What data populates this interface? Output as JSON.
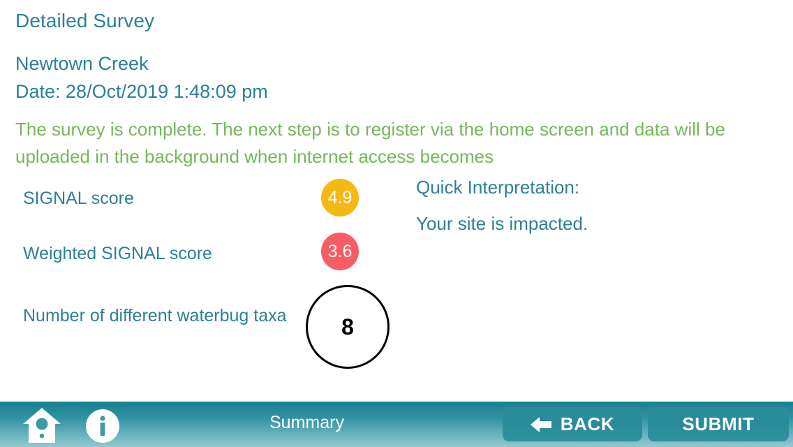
{
  "header": {
    "page_title": "Detailed Survey",
    "site_name": "Newtown Creek",
    "date_line": "Date: 28/Oct/2019 1:48:09 pm"
  },
  "status": {
    "message": "The survey is complete. The next step is to register via the home screen and data will be uploaded in the background when internet access becomes"
  },
  "results": {
    "signal": {
      "label": "SIGNAL score",
      "value": "4.9",
      "color": "#f5b916"
    },
    "weighted_signal": {
      "label": "Weighted SIGNAL score",
      "value": "3.6",
      "color": "#f85c64"
    },
    "taxa": {
      "label": "Number of different waterbug taxa",
      "value": "8",
      "color": "#000000"
    }
  },
  "interpretation": {
    "title": "Quick Interpretation:",
    "text": "Your site is impacted."
  },
  "bottom_bar": {
    "screen_label": "Summary",
    "home_icon": "birdhouse-home-icon",
    "info_icon": "info-circle-icon",
    "back_label": "BACK",
    "back_icon": "arrow-left-icon",
    "submit_label": "SUBMIT"
  },
  "theme": {
    "teal_text": "#2d7f96",
    "green_text": "#74b85a",
    "bar_top": "#17808f",
    "bar_bottom": "#95c8cf",
    "button_fill": "#2b8c9c"
  }
}
